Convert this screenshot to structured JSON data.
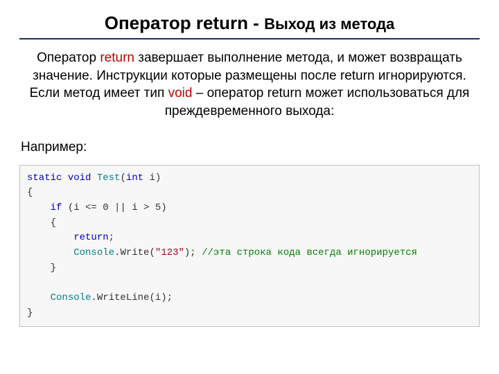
{
  "heading": {
    "main": "Оператор return - ",
    "sub": "Выход из метода"
  },
  "intro": {
    "t1": "Оператор ",
    "t2": "return",
    "t3": " завершает выполнение метода, и может возвращать значение. Инструкции которые размещены после return игнорируются.",
    "t4": "Если метод имеет тип ",
    "t5": "void",
    "t6": " – оператор return может использоваться для преждевременного выхода:"
  },
  "example_label": "Например:",
  "code": {
    "tok": {
      "static": "static",
      "void": "void",
      "Test": "Test",
      "lp": "(",
      "int": "int",
      "sp": " ",
      "i": "i",
      "rp": ")",
      "ob": "{",
      "cb": "}",
      "if": "if",
      "cond": " (i <= 0 || i > 5)",
      "return": "return",
      "semi": ";",
      "console": "Console",
      "dot": ".",
      "write": "Write",
      "wl": "WriteLine",
      "str": "\"123\"",
      "arg_i": "i",
      "comment": "//эта строка кода всегда игнорируется"
    }
  }
}
